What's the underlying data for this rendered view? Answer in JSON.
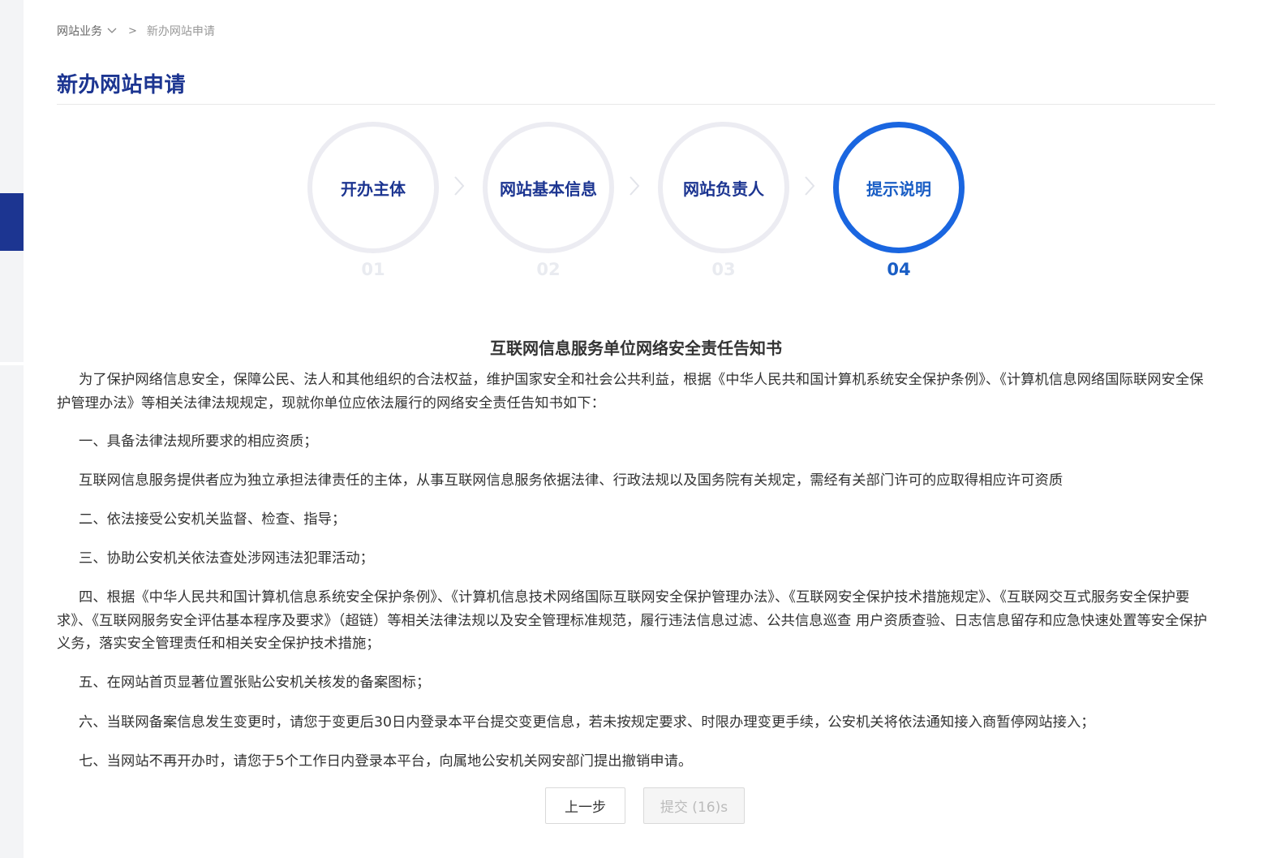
{
  "breadcrumb": {
    "parent": "网站业务",
    "separator": ">",
    "current": "新办网站申请"
  },
  "page_title": "新办网站申请",
  "steps": [
    {
      "label": "开办主体",
      "num": "01",
      "state": "done"
    },
    {
      "label": "网站基本信息",
      "num": "02",
      "state": "done"
    },
    {
      "label": "网站负责人",
      "num": "03",
      "state": "done"
    },
    {
      "label": "提示说明",
      "num": "04",
      "state": "active"
    }
  ],
  "notice": {
    "title": "互联网信息服务单位网络安全责任告知书",
    "intro": "为了保护网络信息安全，保障公民、法人和其他组织的合法权益，维护国家安全和社会公共利益，根据《中华人民共和国计算机系统安全保护条例》、《计算机信息网络国际联网安全保护管理办法》等相关法律法规规定，现就你单位应依法履行的网络安全责任告知书如下：",
    "items": [
      "一、具备法律法规所要求的相应资质；",
      "互联网信息服务提供者应为独立承担法律责任的主体，从事互联网信息服务依据法律、行政法规以及国务院有关规定，需经有关部门许可的应取得相应许可资质",
      "二、依法接受公安机关监督、检查、指导；",
      "三、协助公安机关依法查处涉网违法犯罪活动；",
      "四、根据《中华人民共和国计算机信息系统安全保护条例》、《计算机信息技术网络国际互联网安全保护管理办法》、《互联网安全保护技术措施规定》、《互联网交互式服务安全保护要求》、《互联网服务安全评估基本程序及要求》（超链）等相关法律法规以及安全管理标准规范，履行违法信息过滤、公共信息巡查 用户资质查验、日志信息留存和应急快速处置等安全保护义务，落实安全管理责任和相关安全保护技术措施；",
      "五、在网站首页显著位置张贴公安机关核发的备案图标；",
      "六、当联网备案信息发生变更时，请您于变更后30日内登录本平台提交变更信息，若未按规定要求、时限办理变更手续，公安机关将依法通知接入商暂停网站接入；",
      "七、当网站不再开办时，请您于5个工作日内登录本平台，向属地公安机关网安部门提出撤销申请。"
    ]
  },
  "actions": {
    "prev_label": "上一步",
    "submit_label": "提交 (16)s"
  },
  "colors": {
    "brand_navy": "#1c3591",
    "active_blue": "#1a66e0",
    "step_ring": "#ececf2"
  },
  "icons": {
    "breadcrumb_dropdown": "chevron-down-icon",
    "step_separator": "chevron-right-icon"
  }
}
